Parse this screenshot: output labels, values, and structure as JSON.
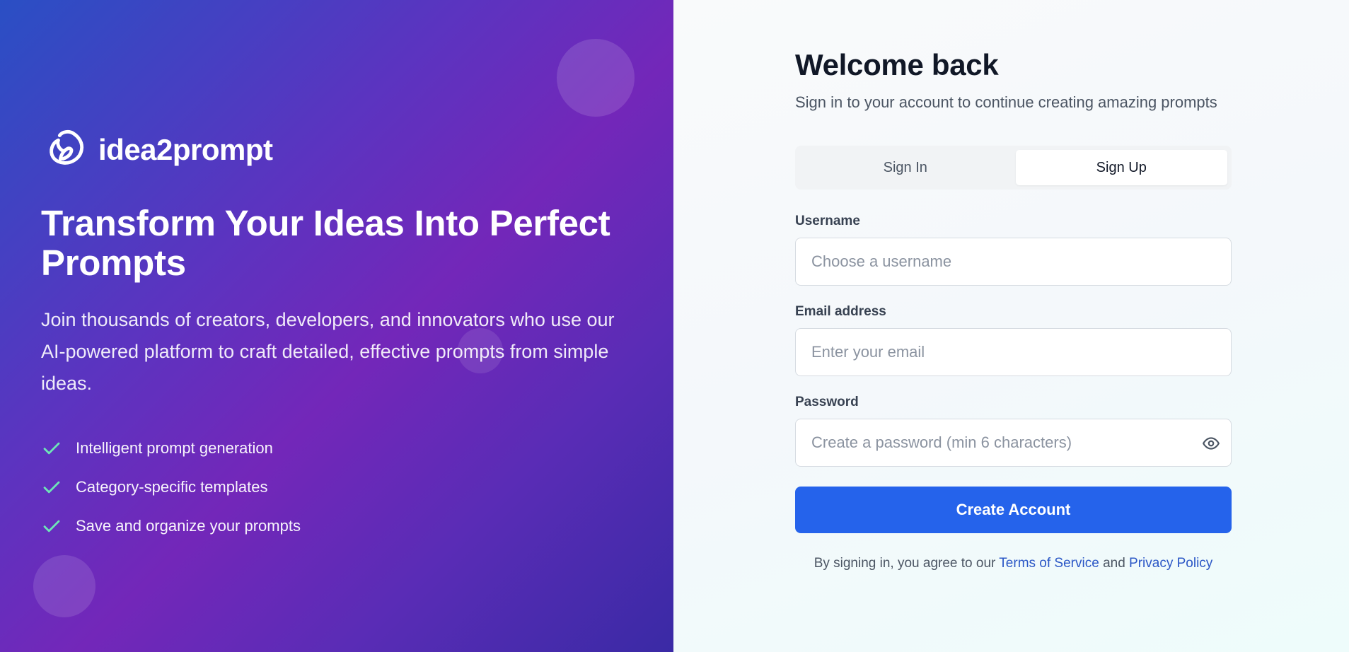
{
  "brand": {
    "name": "idea2prompt"
  },
  "hero": {
    "title": "Transform Your Ideas Into Perfect Prompts",
    "description": "Join thousands of creators, developers, and innovators who use our AI-powered platform to craft detailed, effective prompts from simple ideas.",
    "features": [
      "Intelligent prompt generation",
      "Category-specific templates",
      "Save and organize your prompts"
    ]
  },
  "auth": {
    "title": "Welcome back",
    "subtitle": "Sign in to your account to continue creating amazing prompts",
    "tabs": [
      {
        "label": "Sign In",
        "active": false
      },
      {
        "label": "Sign Up",
        "active": true
      }
    ],
    "fields": {
      "username": {
        "label": "Username",
        "placeholder": "Choose a username",
        "value": ""
      },
      "email": {
        "label": "Email address",
        "placeholder": "Enter your email",
        "value": ""
      },
      "password": {
        "label": "Password",
        "placeholder": "Create a password (min 6 characters)",
        "value": ""
      }
    },
    "submit_label": "Create Account",
    "legal": {
      "prefix": "By signing in, you agree to our",
      "terms": "Terms of Service",
      "and": "and",
      "privacy": "Privacy Policy"
    }
  },
  "colors": {
    "primary": "#2563eb",
    "link": "#2b57c6",
    "check": "#6ee7b7"
  }
}
